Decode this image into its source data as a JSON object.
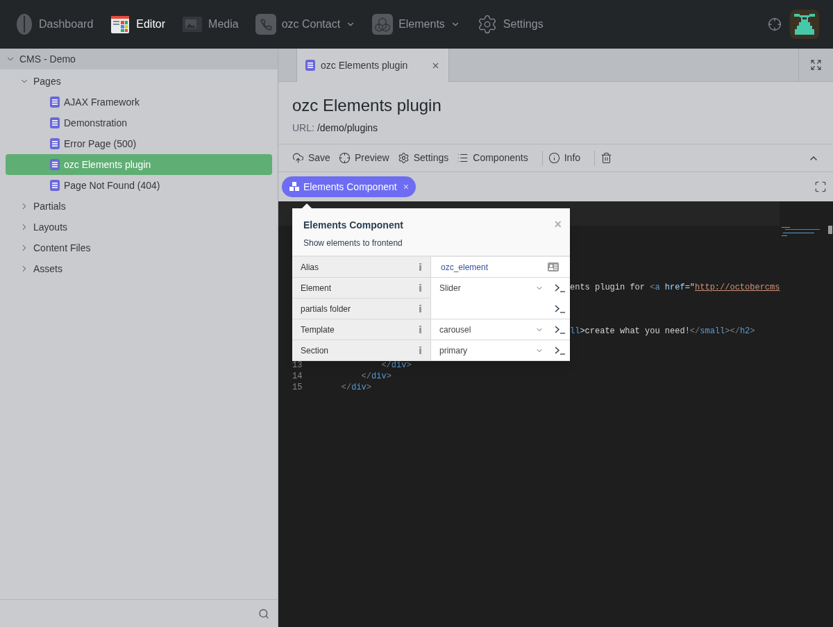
{
  "nav": {
    "items": [
      {
        "label": "Dashboard",
        "kind": "leaf",
        "selected": false,
        "dropdown": false
      },
      {
        "label": "Editor",
        "kind": "editor",
        "selected": true,
        "dropdown": false
      },
      {
        "label": "Media",
        "kind": "media",
        "selected": false,
        "dropdown": false
      },
      {
        "label": "ozc Contact",
        "kind": "contact",
        "selected": false,
        "dropdown": true
      },
      {
        "label": "Elements",
        "kind": "cubes",
        "selected": false,
        "dropdown": true
      },
      {
        "label": "Settings",
        "kind": "gear",
        "selected": false,
        "dropdown": false
      }
    ]
  },
  "sidebar": {
    "tree": [
      {
        "label": "CMS - Demo",
        "expanded": true,
        "children": [
          {
            "label": "Pages",
            "expanded": true,
            "children": [
              {
                "label": "AJAX Framework",
                "selected": false
              },
              {
                "label": "Demonstration",
                "selected": false
              },
              {
                "label": "Error Page (500)",
                "selected": false
              },
              {
                "label": "ozc Elements plugin",
                "selected": true
              },
              {
                "label": "Page Not Found (404)",
                "selected": false
              }
            ]
          },
          {
            "label": "Partials",
            "expanded": false
          },
          {
            "label": "Layouts",
            "expanded": false
          },
          {
            "label": "Content Files",
            "expanded": false
          },
          {
            "label": "Assets",
            "expanded": false
          }
        ]
      }
    ]
  },
  "tabs": [
    {
      "label": "ozc Elements plugin",
      "selected": true
    }
  ],
  "page": {
    "title": "ozc Elements plugin",
    "url_label": "URL:",
    "url": "/demo/plugins"
  },
  "toolbar": [
    {
      "label": "Save",
      "kind": "save"
    },
    {
      "label": "Preview",
      "kind": "preview"
    },
    {
      "label": "Settings",
      "kind": "settings"
    },
    {
      "label": "Components",
      "kind": "components"
    },
    {
      "kind": "divider"
    },
    {
      "label": "Info",
      "kind": "info"
    },
    {
      "kind": "divider"
    },
    {
      "kind": "delete"
    }
  ],
  "component_chip": {
    "label": "Elements Component",
    "close": "×"
  },
  "code": [
    {
      "kind": "partial",
      "tokens": [
        {
          "t": "ents plugin for ",
          "kind": "text"
        },
        {
          "t": "<",
          "kind": "punct"
        },
        {
          "t": "a",
          "kind": "tag"
        },
        {
          "t": " href",
          "kind": "attr"
        },
        {
          "t": "=\"",
          "kind": "text"
        },
        {
          "t": "http://octobercms",
          "kind": "string"
        }
      ]
    },
    {
      "kind": "partial",
      "tokens": [
        {
          "t": "ll",
          "kind": "tag"
        },
        {
          "t": ">create what you need!",
          "kind": "text"
        },
        {
          "t": "</",
          "kind": "punct"
        },
        {
          "t": "small",
          "kind": "tag"
        },
        {
          "t": "></",
          "kind": "punct"
        },
        {
          "t": "h2",
          "kind": "tag"
        },
        {
          "t": ">",
          "kind": "punct"
        }
      ]
    },
    {
      "kind": "full",
      "number": "13",
      "tokens": [
        {
          "t": "            </",
          "kind": "punct"
        },
        {
          "t": "div",
          "kind": "tag"
        },
        {
          "t": ">",
          "kind": "punct"
        }
      ]
    },
    {
      "kind": "full",
      "number": "14",
      "tokens": [
        {
          "t": "        </",
          "kind": "punct"
        },
        {
          "t": "div",
          "kind": "tag"
        },
        {
          "t": ">",
          "kind": "punct"
        }
      ]
    },
    {
      "kind": "full",
      "number": "15",
      "tokens": [
        {
          "t": "    </",
          "kind": "punct"
        },
        {
          "t": "div",
          "kind": "tag"
        },
        {
          "t": ">",
          "kind": "punct"
        }
      ]
    }
  ],
  "popover": {
    "title": "Elements Component",
    "subtitle": "Show elements to frontend",
    "close": "×",
    "properties": [
      {
        "label": "Alias",
        "kind": "alias",
        "value": "ozc_element"
      },
      {
        "label": "Element",
        "kind": "dropdown",
        "value": "Slider"
      },
      {
        "label": "partials folder",
        "kind": "empty"
      },
      {
        "label": "Template",
        "kind": "dropdown",
        "value": "carousel"
      },
      {
        "label": "Section",
        "kind": "dropdown",
        "value": "primary"
      }
    ]
  }
}
